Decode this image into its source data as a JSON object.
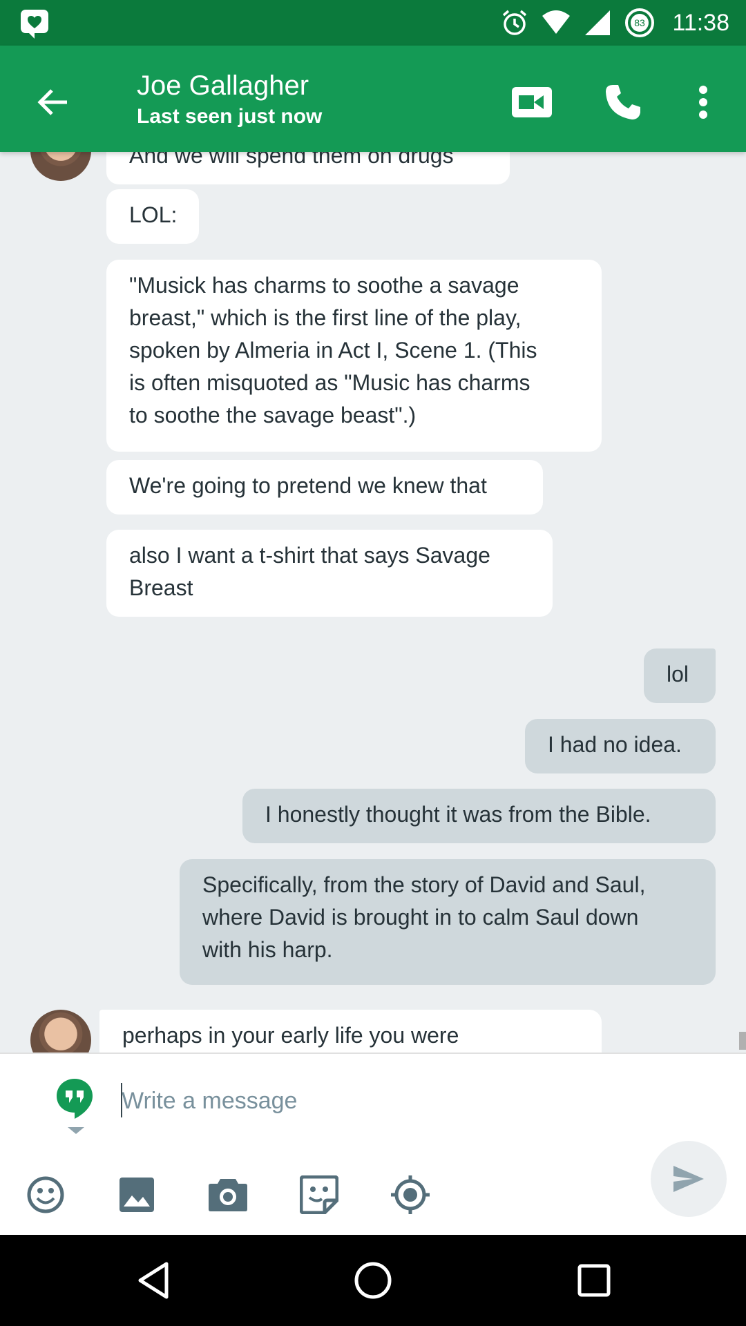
{
  "status_bar": {
    "time": "11:38",
    "battery_level": "83",
    "icons": [
      "hangouts-notification-icon",
      "alarm-icon",
      "wifi-icon",
      "cell-signal-icon",
      "battery-icon"
    ]
  },
  "header": {
    "contact_name": "Joe Gallagher",
    "contact_status": "Last seen just now",
    "actions": [
      "back-arrow-icon",
      "video-call-icon",
      "phone-icon",
      "more-vert-icon"
    ]
  },
  "messages": [
    {
      "direction": "incoming",
      "text": "And we will spend them on drugs"
    },
    {
      "direction": "incoming",
      "text": "LOL:"
    },
    {
      "direction": "incoming",
      "lines": [
        "\"Musick has charms to soothe a savage",
        "breast,\" which is the first line of the play,",
        "spoken by Almeria in Act I, Scene 1. (This",
        "is often misquoted as \"Music has charms",
        "to soothe the savage beast\".)"
      ]
    },
    {
      "direction": "incoming",
      "text": "We're going to pretend we knew that"
    },
    {
      "direction": "incoming",
      "lines": [
        "also I want a t-shirt that says Savage",
        "Breast"
      ]
    },
    {
      "direction": "outgoing",
      "text": "lol"
    },
    {
      "direction": "outgoing",
      "text": "I had no idea."
    },
    {
      "direction": "outgoing",
      "text": "I honestly thought it was from the Bible."
    },
    {
      "direction": "outgoing",
      "lines": [
        "Specifically, from the story of David and Saul,",
        "where David is brought in to calm Saul down",
        "with his harp."
      ]
    },
    {
      "direction": "incoming",
      "text": "perhaps in your early life you were"
    }
  ],
  "composer": {
    "placeholder": "Write a message",
    "value": "",
    "tools": [
      "emoji-icon",
      "image-icon",
      "camera-icon",
      "sticker-icon",
      "location-icon"
    ],
    "send_icon": "send-icon"
  },
  "colors": {
    "status_bar": "#0b7a3c",
    "app_bar": "#149a55",
    "background": "#eceff1",
    "incoming_bubble": "#ffffff",
    "outgoing_bubble": "#cfd8dc"
  }
}
